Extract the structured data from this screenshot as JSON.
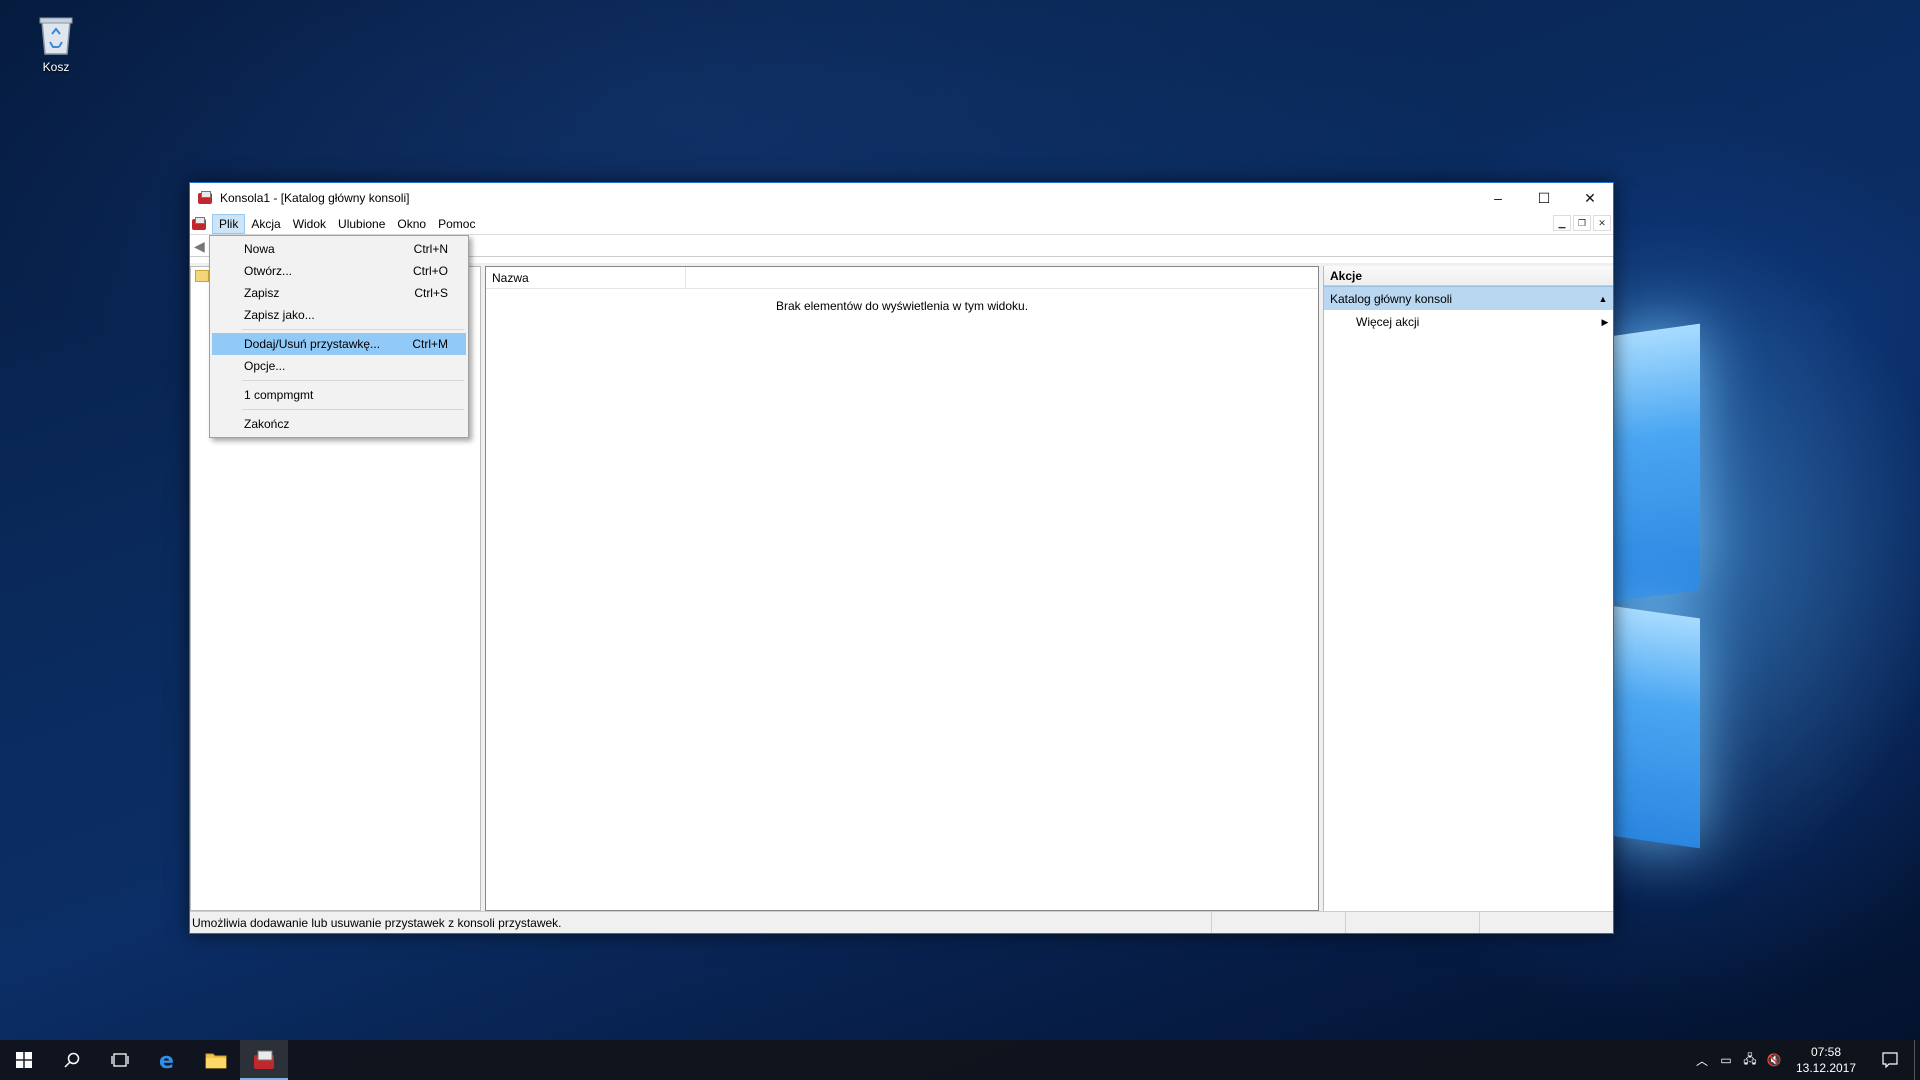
{
  "desktop": {
    "icons": [
      {
        "label": "Kosz",
        "icon": "recycle-bin-icon"
      }
    ]
  },
  "window": {
    "title": "Konsola1 - [Katalog główny konsoli]",
    "controls": {
      "minimize": "–",
      "maximize": "☐",
      "close": "✕"
    }
  },
  "menubar": {
    "items": [
      "Plik",
      "Akcja",
      "Widok",
      "Ulubione",
      "Okno",
      "Pomoc"
    ],
    "active": "Plik"
  },
  "file_menu": {
    "items": [
      {
        "label": "Nowa",
        "shortcut": "Ctrl+N"
      },
      {
        "label": "Otwórz...",
        "shortcut": "Ctrl+O"
      },
      {
        "label": "Zapisz",
        "shortcut": "Ctrl+S"
      },
      {
        "label": "Zapisz jako...",
        "shortcut": ""
      },
      {
        "label": "Dodaj/Usuń przystawkę...",
        "shortcut": "Ctrl+M"
      },
      {
        "label": "Opcje...",
        "shortcut": ""
      },
      {
        "label": "1 compmgmt",
        "shortcut": ""
      },
      {
        "label": "Zakończ",
        "shortcut": ""
      }
    ],
    "highlighted": "Dodaj/Usuń przystawkę..."
  },
  "main_pane": {
    "column_header": "Nazwa",
    "empty_message": "Brak elementów do wyświetlenia w tym widoku."
  },
  "actions_pane": {
    "header": "Akcje",
    "section": "Katalog główny konsoli",
    "more": "Więcej akcji"
  },
  "statusbar": {
    "message": "Umożliwia dodawanie lub usuwanie przystawek z konsoli przystawek."
  },
  "taskbar": {
    "time": "07:58",
    "date": "13.12.2017"
  }
}
